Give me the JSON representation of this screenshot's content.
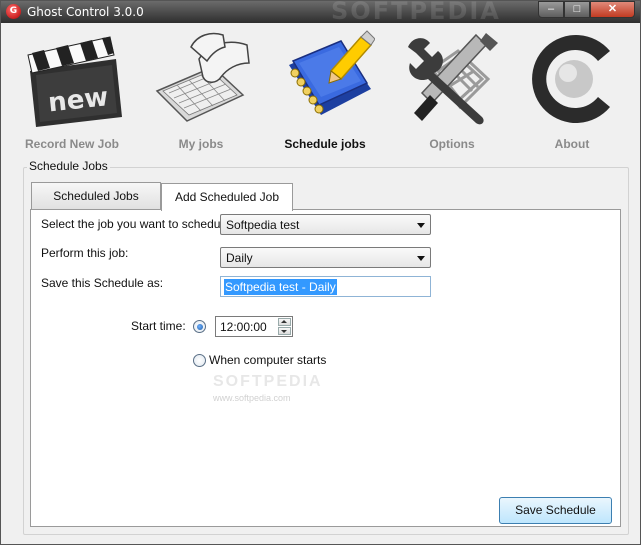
{
  "window": {
    "title": "Ghost Control 3.0.0",
    "app_icon_letter": "G",
    "watermark": "SOFTPEDIA",
    "controls": {
      "minimize": "–",
      "maximize": "□",
      "close": "✕"
    }
  },
  "toolbar": {
    "items": [
      {
        "label": "Record New Job",
        "icon": "clapperboard-new-icon",
        "active": false
      },
      {
        "label": "My jobs",
        "icon": "keyboard-hands-icon",
        "active": false
      },
      {
        "label": "Schedule jobs",
        "icon": "notebook-pencil-icon",
        "active": true
      },
      {
        "label": "Options",
        "icon": "tools-icon",
        "active": false
      },
      {
        "label": "About",
        "icon": "c-logo-icon",
        "active": false
      }
    ],
    "clapper_text": "new"
  },
  "group": {
    "label": "Schedule Jobs"
  },
  "tabs": [
    {
      "label": "Scheduled Jobs",
      "selected": false
    },
    {
      "label": "Add Scheduled Job",
      "selected": true
    }
  ],
  "form": {
    "job_label": "Select the job you want to schedule:",
    "job_value": "Softpedia test",
    "perform_label": "Perform this job:",
    "perform_value": "Daily",
    "save_as_label": "Save this Schedule as:",
    "save_as_value": "Softpedia test - Daily",
    "start_time_label": "Start time:",
    "start_time_value": "12:00:00",
    "start_time_selected": true,
    "when_computer_starts_label": "When computer starts",
    "when_computer_starts_selected": false
  },
  "watermark_center": "SOFTPEDIA",
  "watermark_url": "www.softpedia.com",
  "save_button": "Save Schedule",
  "colors": {
    "titlebar": "#3f3f3f",
    "close_button": "#c23b22",
    "notebook_blue": "#2a55c8",
    "pencil_yellow": "#ffcc00",
    "selection": "#3399ff"
  }
}
